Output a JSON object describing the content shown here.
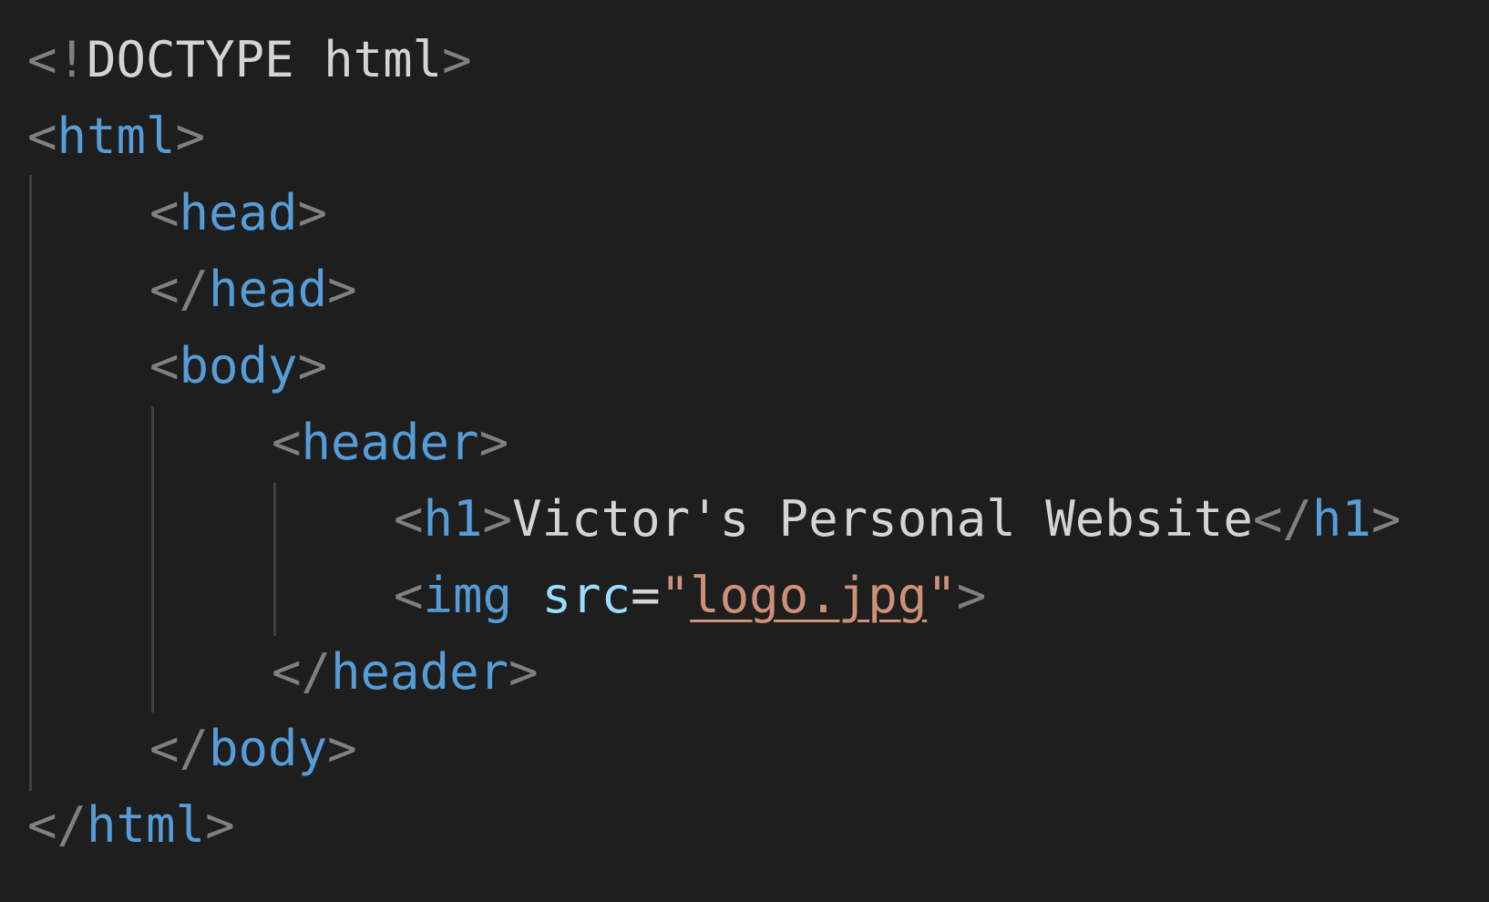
{
  "code": {
    "line1": {
      "open": "<!",
      "keyword": "DOCTYPE",
      "rest": " html",
      "close": ">"
    },
    "line2": {
      "open": "<",
      "tag": "html",
      "close": ">"
    },
    "line3": {
      "open": "<",
      "tag": "head",
      "close": ">"
    },
    "line4": {
      "open": "</",
      "tag": "head",
      "close": ">"
    },
    "line5": {
      "open": "<",
      "tag": "body",
      "close": ">"
    },
    "line6": {
      "open": "<",
      "tag": "header",
      "close": ">"
    },
    "line7": {
      "open": "<",
      "tag": "h1",
      "close": ">",
      "text": "Victor's Personal Website",
      "end_open": "</",
      "end_tag": "h1",
      "end_close": ">"
    },
    "line8": {
      "open": "<",
      "tag": "img",
      "attr": "src",
      "eq": "=",
      "q1": "\"",
      "value": "logo.jpg",
      "q2": "\"",
      "close": ">"
    },
    "line9": {
      "open": "</",
      "tag": "header",
      "close": ">"
    },
    "line10": {
      "open": "</",
      "tag": "body",
      "close": ">"
    },
    "line11": {
      "open": "</",
      "tag": "html",
      "close": ">"
    }
  },
  "colors": {
    "background": "#1e1e1e",
    "punctuation": "#808080",
    "tag": "#569cd6",
    "attribute": "#9cdcfe",
    "string": "#ce9178",
    "text": "#d4d4d4",
    "indent_guide": "#404040"
  }
}
